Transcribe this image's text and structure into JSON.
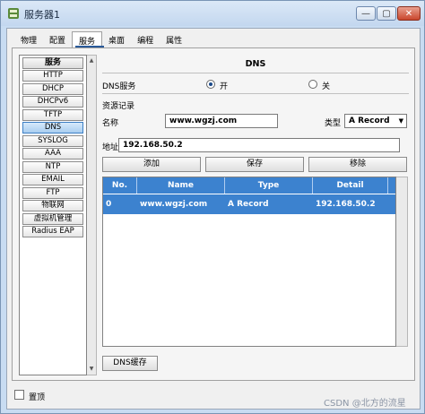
{
  "window": {
    "title": "服务器1"
  },
  "tabs": [
    {
      "label": "物理"
    },
    {
      "label": "配置"
    },
    {
      "label": "服务"
    },
    {
      "label": "桌面"
    },
    {
      "label": "编程"
    },
    {
      "label": "属性"
    }
  ],
  "active_tab": "服务",
  "services": {
    "header": "服务",
    "items": [
      {
        "label": "HTTP"
      },
      {
        "label": "DHCP"
      },
      {
        "label": "DHCPv6"
      },
      {
        "label": "TFTP"
      },
      {
        "label": "DNS"
      },
      {
        "label": "SYSLOG"
      },
      {
        "label": "AAA"
      },
      {
        "label": "NTP"
      },
      {
        "label": "EMAIL"
      },
      {
        "label": "FTP"
      },
      {
        "label": "物联网"
      },
      {
        "label": "虚拟机管理"
      },
      {
        "label": "Radius EAP"
      }
    ],
    "selected": "DNS"
  },
  "dns": {
    "title": "DNS",
    "service_label": "DNS服务",
    "on_label": "开",
    "off_label": "关",
    "service_state": "on",
    "records_label": "资源记录",
    "name_label": "名称",
    "name_value": "www.wgzj.com",
    "type_label": "类型",
    "type_value": "A Record",
    "address_label": "地址",
    "address_value": "192.168.50.2",
    "add_button": "添加",
    "save_button": "保存",
    "remove_button": "移除",
    "table": {
      "columns": [
        "No.",
        "Name",
        "Type",
        "Detail"
      ],
      "rows": [
        {
          "no": "0",
          "name": "www.wgzj.com",
          "type": "A Record",
          "detail": "192.168.50.2"
        }
      ]
    },
    "cache_button": "DNS缓存"
  },
  "bottom": {
    "checkbox_label": "置顶"
  },
  "watermark": "CSDN @北方的流星",
  "colors": {
    "selection": "#3c82cf",
    "accent": "#2a5a9a"
  }
}
